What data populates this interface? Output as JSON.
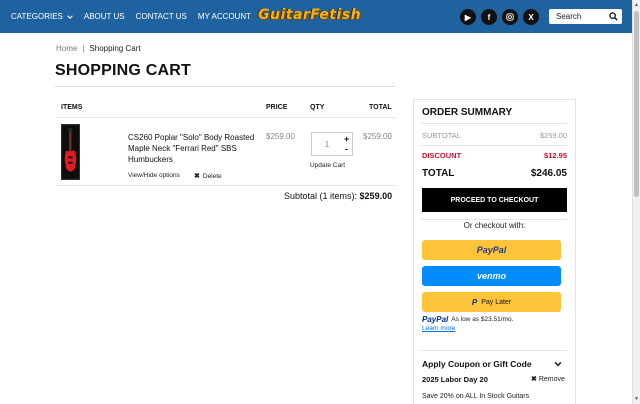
{
  "header": {
    "nav": [
      "CATEGORIES",
      "ABOUT US",
      "CONTACT US",
      "MY ACCOUNT"
    ],
    "logo": "GuitarFetish",
    "social": [
      "youtube-icon",
      "facebook-icon",
      "instagram-icon",
      "x-icon"
    ],
    "search_placeholder": "Search"
  },
  "breadcrumb": {
    "home": "Home",
    "sep": "|",
    "current": "Shopping Cart"
  },
  "page_title": "SHOPPING CART",
  "cart": {
    "headers": {
      "items": "ITEMS",
      "price": "PRICE",
      "qty": "QTY",
      "total": "TOTAL"
    },
    "item": {
      "name": "CS260 Poplar \"Solo\" Body Roasted Maple Neck \"Ferrari Red\" SBS Humbuckers",
      "view_hide": "View/Hide options",
      "delete": "Delete",
      "price": "$259.00",
      "quantity": "1",
      "total": "$259.00",
      "update": "Update Cart"
    },
    "subtotal_label": "Subtotal (1 items):",
    "subtotal_value": "$259.00"
  },
  "summary": {
    "title": "ORDER SUMMARY",
    "subtotal_label": "SUBTOTAL",
    "subtotal_value": "$259.00",
    "discount_label": "DISCOUNT",
    "discount_value": "$12.95",
    "total_label": "TOTAL",
    "total_value": "$246.05",
    "checkout": "PROCEED TO CHECKOUT",
    "or": "Or checkout with:",
    "paypal": "PayPal",
    "venmo": "venmo",
    "paylater": "Pay Later",
    "paylater_brand": "PayPal",
    "paylater_msg": "As low as $23.51/mo.",
    "learn_more": "Learn more",
    "coupon_header": "Apply Coupon or Gift Code",
    "coupon_name": "2025 Labor Day 20",
    "coupon_remove": "Remove",
    "coupon_desc": "Save 20% on ALL In Stock Guitars"
  },
  "colors": {
    "header": "#1f62a0",
    "discount": "#c8102e",
    "paypal_yellow": "#ffc439",
    "venmo_blue": "#008cff"
  }
}
